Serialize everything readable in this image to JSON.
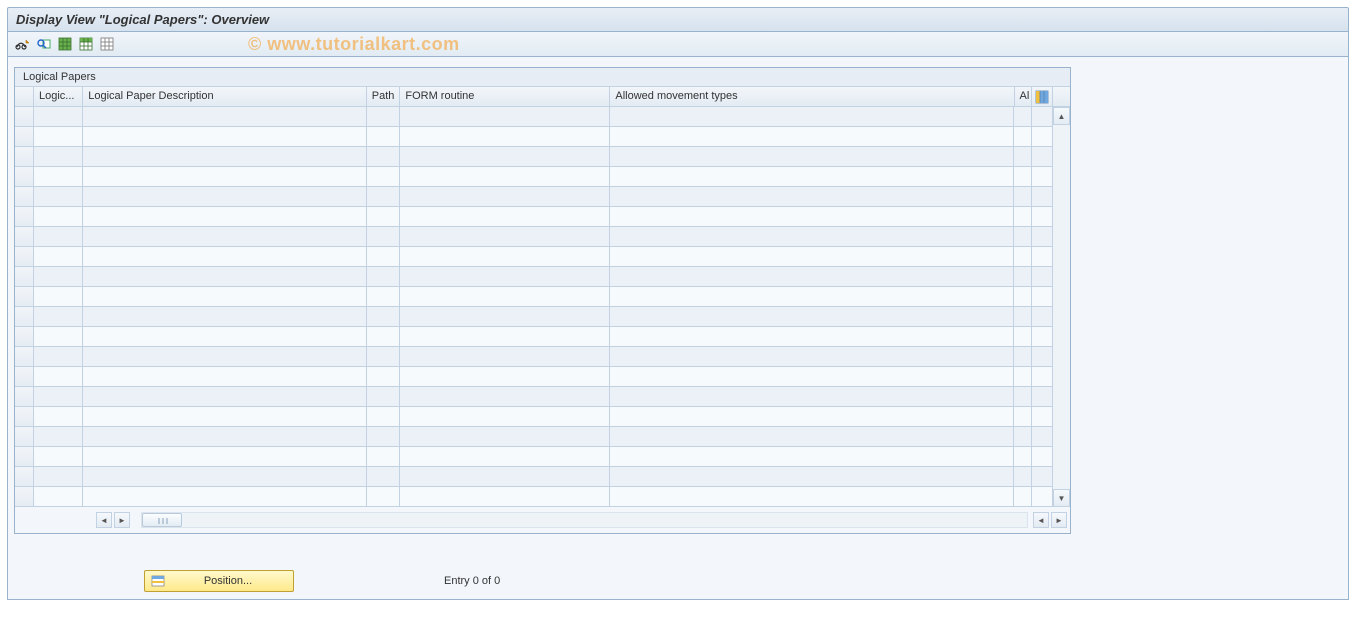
{
  "header": {
    "title": "Display View \"Logical Papers\": Overview"
  },
  "toolbar": {
    "icons": [
      "glasses",
      "search-detail",
      "table-green",
      "table-export",
      "table-list"
    ]
  },
  "watermark": "© www.tutorialkart.com",
  "table": {
    "title": "Logical Papers",
    "columns": [
      {
        "key": "logic",
        "label": "Logic...",
        "width_class": "c0"
      },
      {
        "key": "desc",
        "label": "Logical Paper Description",
        "width_class": "c1"
      },
      {
        "key": "path",
        "label": "Path",
        "width_class": "c2"
      },
      {
        "key": "form",
        "label": "FORM routine",
        "width_class": "c3"
      },
      {
        "key": "allowed",
        "label": "Allowed movement types",
        "width_class": "c4"
      },
      {
        "key": "al",
        "label": "Al",
        "width_class": "c5"
      }
    ],
    "row_count": 20
  },
  "footer": {
    "position_label": "Position...",
    "entry_text": "Entry 0 of 0"
  }
}
